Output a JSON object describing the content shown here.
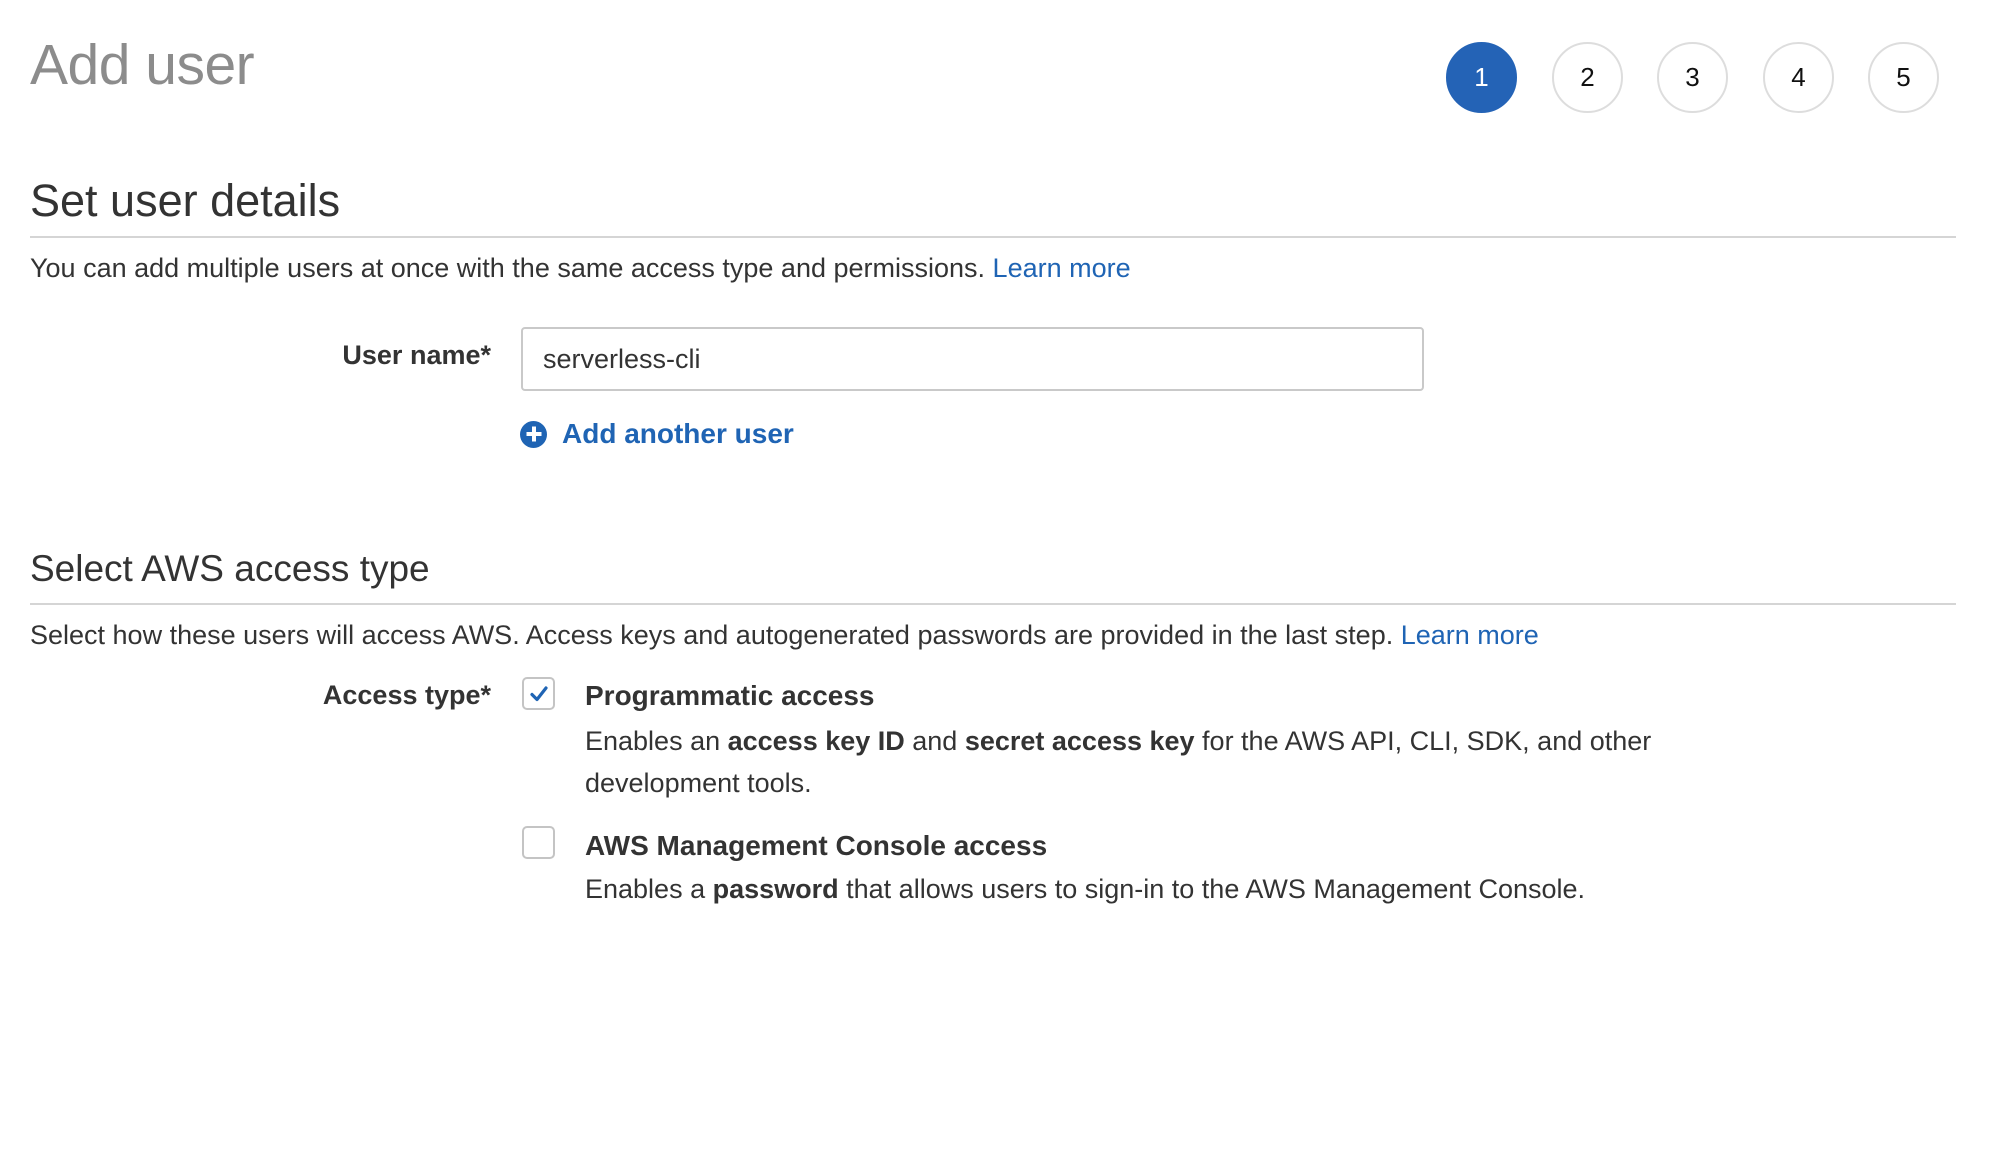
{
  "header": {
    "title": "Add user",
    "steps": [
      "1",
      "2",
      "3",
      "4",
      "5"
    ],
    "active_step": "1",
    "accent_color": "#2463b6"
  },
  "user_details": {
    "title": "Set user details",
    "description": "You can add multiple users at once with the same access type and permissions.",
    "learn_more": "Learn more",
    "username_label": "User name*",
    "username_value": "serverless-cli",
    "add_another": "Add another user",
    "add_icon": "plus-circle-icon"
  },
  "access_type": {
    "title": "Select AWS access type",
    "description": "Select how these users will access AWS. Access keys and autogenerated passwords are provided in the last step.",
    "learn_more": "Learn more",
    "label": "Access type*",
    "options": [
      {
        "title": "Programmatic access",
        "checked": true,
        "desc_parts": [
          "Enables an ",
          "access key ID",
          " and ",
          "secret access key",
          " for the AWS API, CLI, SDK, and other development tools."
        ]
      },
      {
        "title": "AWS Management Console access",
        "checked": false,
        "desc_parts": [
          "Enables a ",
          "password",
          " that allows users to sign-in to the AWS Management Console."
        ]
      }
    ],
    "check_icon": "checkmark-icon",
    "link_color": "#1f64b4"
  }
}
